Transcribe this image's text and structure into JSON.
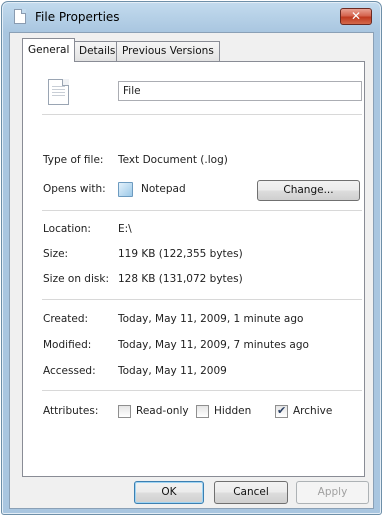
{
  "window": {
    "title": "File Properties",
    "close_glyph": "✕"
  },
  "tabs": [
    {
      "label": "General",
      "active": true
    },
    {
      "label": "Details",
      "active": false
    },
    {
      "label": "Previous Versions",
      "active": false
    }
  ],
  "general": {
    "file_icon": "text-document-icon",
    "file_name": "File",
    "type_label": "Type of file:",
    "type_value": "Text Document (.log)",
    "opens_label": "Opens with:",
    "opens_icon": "notepad-icon",
    "opens_value": "Notepad",
    "change_button": "Change...",
    "location_label": "Location:",
    "location_value": "E:\\",
    "size_label": "Size:",
    "size_value": "119 KB (122,355 bytes)",
    "size_on_disk_label": "Size on disk:",
    "size_on_disk_value": "128 KB (131,072 bytes)",
    "created_label": "Created:",
    "created_value": "Today, May 11, 2009, 1 minute ago",
    "modified_label": "Modified:",
    "modified_value": "Today, May 11, 2009, 7 minutes ago",
    "accessed_label": "Accessed:",
    "accessed_value": "Today, May 11, 2009",
    "attributes_label": "Attributes:",
    "attributes": [
      {
        "label": "Read-only",
        "checked": false
      },
      {
        "label": "Hidden",
        "checked": false
      },
      {
        "label": "Archive",
        "checked": true
      }
    ]
  },
  "buttons": {
    "ok": "OK",
    "cancel": "Cancel",
    "apply": "Apply",
    "apply_enabled": false
  }
}
